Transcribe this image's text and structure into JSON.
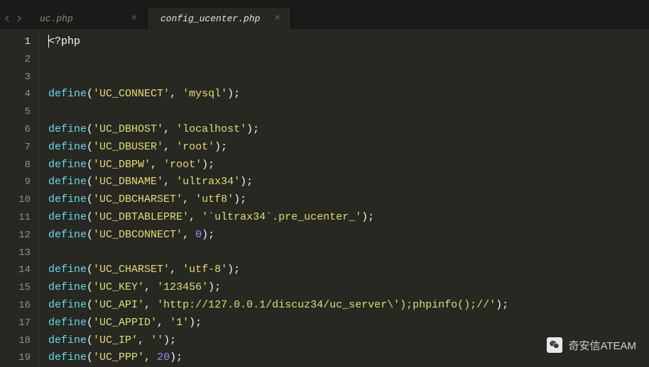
{
  "tabs": [
    {
      "label": "uc.php",
      "active": false
    },
    {
      "label": "config_ucenter.php",
      "active": true
    }
  ],
  "code": {
    "open_tag": "<?php",
    "lines": [
      {
        "n": 1
      },
      {
        "n": 2
      },
      {
        "n": 3
      },
      {
        "n": 4,
        "k": "UC_CONNECT",
        "v": "mysql",
        "t": "s"
      },
      {
        "n": 5
      },
      {
        "n": 6,
        "k": "UC_DBHOST",
        "v": "localhost",
        "t": "s"
      },
      {
        "n": 7,
        "k": "UC_DBUSER",
        "v": "root",
        "t": "s"
      },
      {
        "n": 8,
        "k": "UC_DBPW",
        "v": "root",
        "t": "s"
      },
      {
        "n": 9,
        "k": "UC_DBNAME",
        "v": "ultrax34",
        "t": "s"
      },
      {
        "n": 10,
        "k": "UC_DBCHARSET",
        "v": "utf8",
        "t": "s"
      },
      {
        "n": 11,
        "k": "UC_DBTABLEPRE",
        "v": "`ultrax34`.pre_ucenter_",
        "t": "s"
      },
      {
        "n": 12,
        "k": "UC_DBCONNECT",
        "v": "0",
        "t": "n"
      },
      {
        "n": 13
      },
      {
        "n": 14,
        "k": "UC_CHARSET",
        "v": "utf-8",
        "t": "s"
      },
      {
        "n": 15,
        "k": "UC_KEY",
        "v": "123456",
        "t": "s"
      },
      {
        "n": 16,
        "k": "UC_API",
        "v": "http://127.0.0.1/discuz34/uc_server\\');phpinfo();//",
        "t": "s"
      },
      {
        "n": 17,
        "k": "UC_APPID",
        "v": "1",
        "t": "s"
      },
      {
        "n": 18,
        "k": "UC_IP",
        "v": "",
        "t": "s"
      },
      {
        "n": 19,
        "k": "UC_PPP",
        "v": "20",
        "t": "n"
      }
    ]
  },
  "watermark": "奇安信ATEAM"
}
